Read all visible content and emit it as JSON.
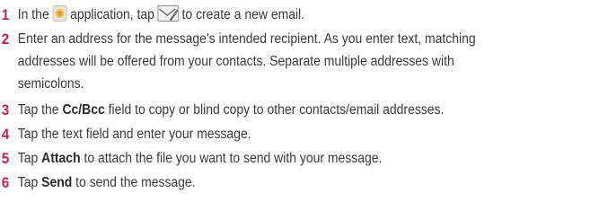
{
  "steps": [
    {
      "number": "1",
      "parts": {
        "before_app_icon": "In the",
        "after_app_icon": "application, tap",
        "after_compose_icon": "to create a new email."
      },
      "icons": {
        "app": "email-app-icon",
        "compose": "compose-email-icon"
      }
    },
    {
      "number": "2",
      "lines": [
        "Enter an address for the message's intended recipient. As you enter text, matching",
        "addresses will be offered from your contacts. Separate multiple addresses with",
        "semicolons."
      ]
    },
    {
      "number": "3",
      "parts": {
        "before": "Tap the",
        "bold": "Cc/Bcc",
        "after": "field to copy or blind copy to other contacts/email addresses."
      }
    },
    {
      "number": "4",
      "text": "Tap the text field and enter your message."
    },
    {
      "number": "5",
      "parts": {
        "before": "Tap",
        "bold": "Attach",
        "after": "to attach the file you want to send with your message."
      }
    },
    {
      "number": "6",
      "parts": {
        "before": "Tap",
        "bold": "Send",
        "after": "to send the message."
      }
    }
  ],
  "colors": {
    "step_number": "#c0205a",
    "text": "#3a3a3a"
  }
}
